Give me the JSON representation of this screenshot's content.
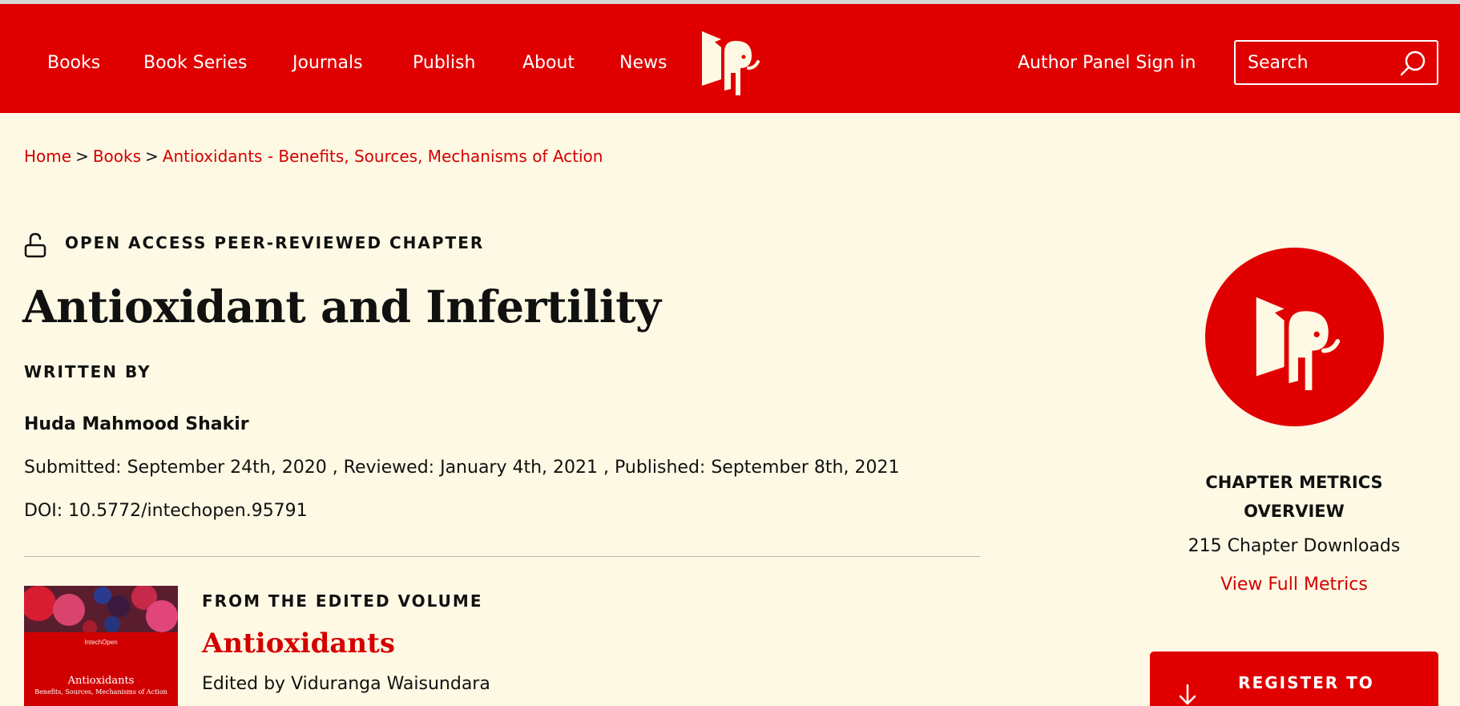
{
  "nav": {
    "links": [
      "Books",
      "Book Series",
      "Journals",
      "Publish",
      "About",
      "News"
    ],
    "author_panel": "Author Panel Sign in",
    "search_placeholder": "Search"
  },
  "breadcrumb": {
    "items": [
      "Home",
      "Books",
      "Antioxidants - Benefits, Sources, Mechanisms of Action"
    ],
    "separator": ">"
  },
  "chapter": {
    "access_label": "OPEN ACCESS PEER-REVIEWED CHAPTER",
    "title": "Antioxidant and Infertility",
    "written_by_label": "WRITTEN BY",
    "author": "Huda Mahmood Shakir",
    "dates": "Submitted: September 24th, 2020 , Reviewed: January 4th, 2021 , Published: September 8th, 2021",
    "doi": "DOI: 10.5772/intechopen.95791"
  },
  "volume": {
    "from_label": "FROM THE EDITED VOLUME",
    "title": "Antioxidants",
    "edited_by": "Edited by Viduranga Waisundara",
    "cover": {
      "publisher": "IntechOpen",
      "title": "Antioxidants",
      "subtitle": "Benefits, Sources, Mechanisms of Action"
    }
  },
  "metrics": {
    "title_line1": "CHAPTER METRICS",
    "title_line2": "OVERVIEW",
    "downloads": "215 Chapter Downloads",
    "view_link": "View Full Metrics"
  },
  "register": {
    "label": "REGISTER TO"
  },
  "colors": {
    "brand_red": "#e00000",
    "link_red": "#d40000",
    "background": "#fdf9e4",
    "logo_cream": "#fdf9e4"
  },
  "icons": [
    "intechopen-logo-icon",
    "search-icon",
    "lock-icon",
    "download-icon"
  ]
}
